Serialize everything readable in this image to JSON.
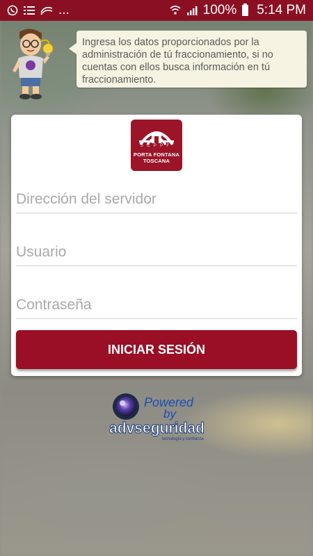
{
  "status_bar": {
    "left_icons": [
      "whatsapp-icon",
      "list-icon",
      "swype-icon"
    ],
    "more": "...",
    "battery": "100%",
    "time": "5:14 PM"
  },
  "tip": {
    "text": "Ingresa los datos proporcionados por la administración de tú fraccionamiento, si no cuentas con ellos busca información en tú fraccionamiento."
  },
  "logo": {
    "name": "PORTA FONTANA TOSCANA",
    "initials": "SCPPF"
  },
  "form": {
    "server_placeholder": "Dirección del servidor",
    "user_placeholder": "Usuario",
    "password_placeholder": "Contraseña",
    "submit_label": "INICIAR SESIÓN"
  },
  "footer": {
    "powered": "Powered",
    "by": "by",
    "brand": "advseguridad",
    "tagline": "tecnología y confianza"
  },
  "colors": {
    "status_bar": "#8a0f23",
    "button": "#9a0f25",
    "bubble": "#f6f3e2"
  }
}
